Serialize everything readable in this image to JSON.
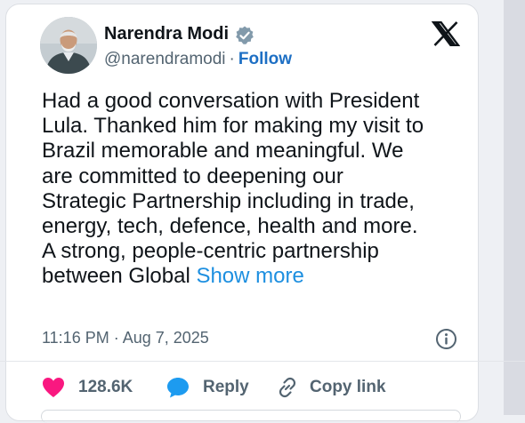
{
  "tweet": {
    "author_name": "Narendra Modi",
    "handle": "@narendramodi",
    "separator": "·",
    "follow_label": "Follow",
    "text_lines": [
      "Had a good conversation with President",
      "Lula. Thanked him for making my visit to",
      "Brazil memorable and meaningful. We",
      "are committed to deepening our",
      "Strategic Partnership including in trade,",
      "energy, tech, defence, health and more.",
      "A strong, people-centric partnership",
      "between Global"
    ],
    "show_more_label": "Show more",
    "timestamp": "11:16 PM · Aug 7, 2025"
  },
  "actions": {
    "like_count": "128.6K",
    "reply_label": "Reply",
    "copy_link_label": "Copy link"
  },
  "colors": {
    "like": "#f91880",
    "reply": "#1d9bf0",
    "link": "#1d8fe0",
    "verified": "#829aab"
  },
  "icons": {
    "verified": "verified-badge-icon",
    "logo": "x-logo-icon",
    "info": "info-icon",
    "like": "heart-icon",
    "reply": "speech-bubble-icon",
    "copy": "link-icon"
  }
}
